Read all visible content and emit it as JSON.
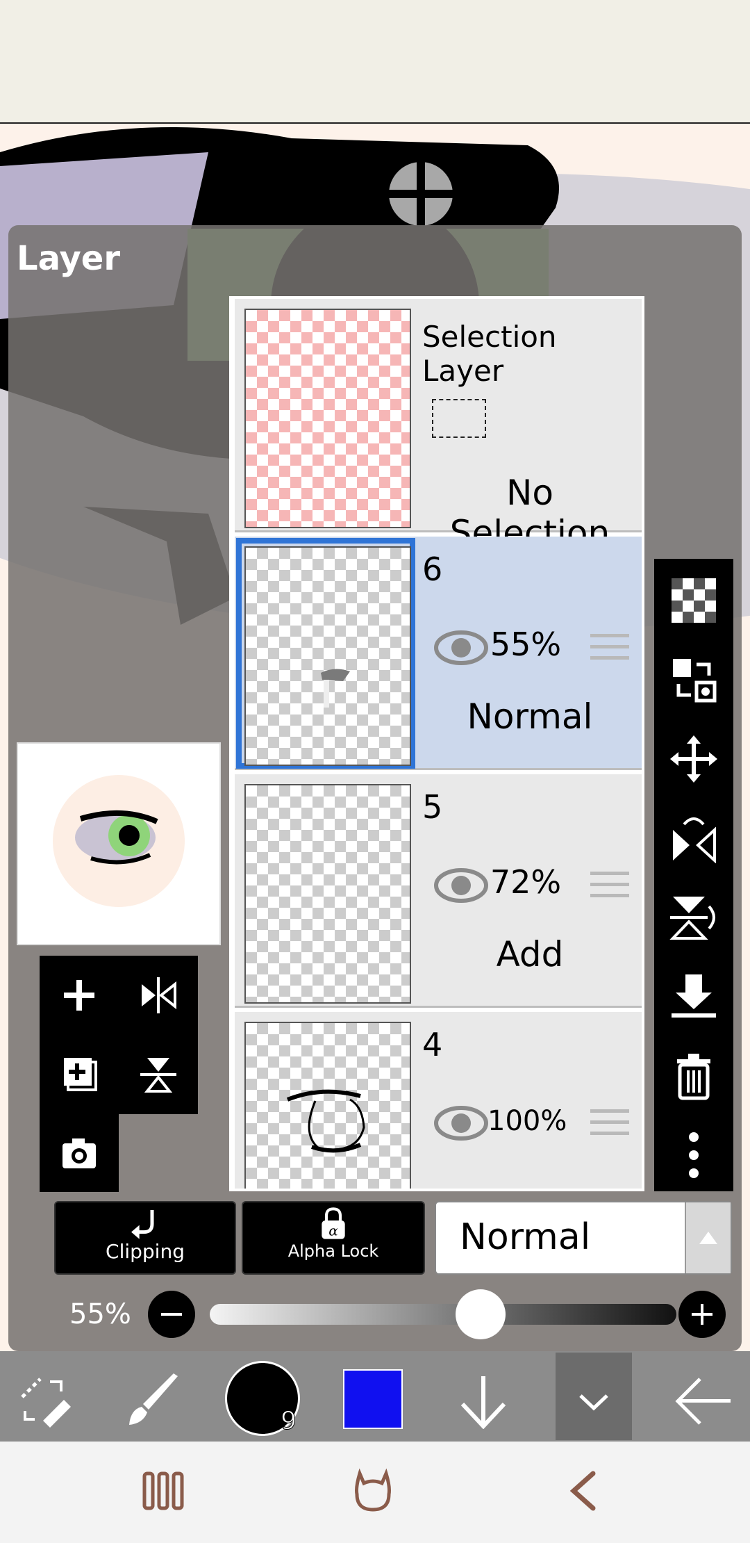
{
  "panel": {
    "title": "Layer"
  },
  "layers": [
    {
      "name": "Selection Layer",
      "status": "No Selection"
    },
    {
      "name": "6",
      "opacity": "55%",
      "blend": "Normal",
      "selected": true
    },
    {
      "name": "5",
      "opacity": "72%",
      "blend": "Add"
    },
    {
      "name": "4",
      "opacity": "100%"
    }
  ],
  "bottom": {
    "clipping_label": "Clipping",
    "alpha_lock_label": "Alpha Lock",
    "blend_mode": "Normal",
    "opacity_label": "55%",
    "opacity_value": 0.55
  },
  "brush_size": "9",
  "colors": {
    "current_color": "#1010f0",
    "selected_highlight": "#2f74d6"
  },
  "icons": {
    "left_tools": [
      "add-layer-icon",
      "flip-horizontal-icon",
      "add-copy-layer-icon",
      "flip-vertical-icon",
      "camera-icon"
    ],
    "right_tools": [
      "transparency-icon",
      "layer-swap-icon",
      "move-icon",
      "flip-horizontal-icon",
      "flip-vertical-icon",
      "merge-down-icon",
      "trash-icon",
      "more-icon"
    ],
    "bottom_tools": [
      "transform-icon",
      "brush-icon",
      "brush-size-icon",
      "color-icon",
      "arrow-down-icon",
      "collapse-icon",
      "back-arrow-icon"
    ],
    "nav": [
      "recent-apps-icon",
      "home-icon",
      "back-icon"
    ]
  }
}
